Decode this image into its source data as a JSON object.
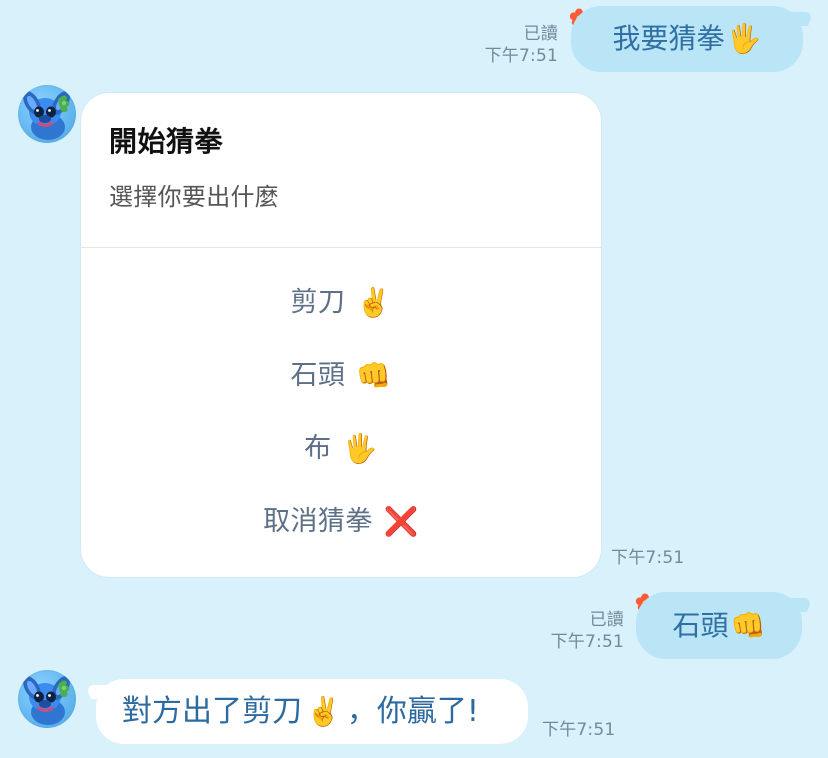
{
  "messages": [
    {
      "side": "right",
      "read": "已讀",
      "time": "下午7:51",
      "text": "我要猜拳",
      "emoji": "🖐️"
    },
    {
      "side": "left",
      "card": {
        "title": "開始猜拳",
        "subtitle": "選擇你要出什麼",
        "options": [
          {
            "label": "剪刀",
            "emoji": "✌️"
          },
          {
            "label": "石頭",
            "emoji": "👊"
          },
          {
            "label": "布",
            "emoji": "🖐️"
          },
          {
            "label": "取消猜拳",
            "emoji": "❌"
          }
        ]
      },
      "time": "下午7:51"
    },
    {
      "side": "right",
      "read": "已讀",
      "time": "下午7:51",
      "text": "石頭",
      "emoji": "👊"
    },
    {
      "side": "left",
      "text_prefix": "對方出了剪刀",
      "emoji": "✌️",
      "text_suffix": "，你贏了!",
      "time": "下午7:51"
    }
  ],
  "icons": {
    "avatar": "stitch-avatar",
    "read_decoration": "hibiscus-icon"
  },
  "colors": {
    "background": "#d8f1fb",
    "outgoing_bubble": "#b9e5f6",
    "incoming_bubble": "#ffffff",
    "meta_text": "#6e8a9d"
  }
}
